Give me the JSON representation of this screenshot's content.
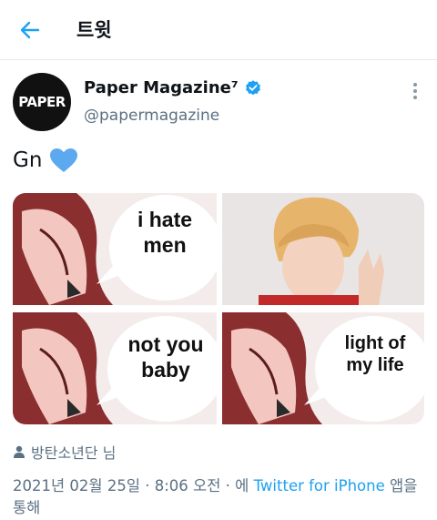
{
  "topbar": {
    "title": "트윗"
  },
  "author": {
    "avatar_text": "PAPER",
    "display_name": "Paper Magazine⁷",
    "handle": "@papermagazine"
  },
  "tweet": {
    "text": "Gn"
  },
  "media": {
    "panels": [
      {
        "text_line1": "i hate",
        "text_line2": "men"
      },
      {
        "text_line1": "",
        "text_line2": ""
      },
      {
        "text_line1": "not you",
        "text_line2": "baby"
      },
      {
        "text_line1": "light of",
        "text_line2": "my life"
      }
    ]
  },
  "liker": {
    "text": "방탄소년단 님"
  },
  "meta": {
    "timestamp": "2021년 02월 25일 · 8:06 오전 · 에",
    "source": "Twitter for iPhone",
    "suffix": "앱을 통해"
  },
  "colors": {
    "accent": "#1da1f2",
    "secondary": "#5b7083",
    "heart": "#5da9f0"
  }
}
